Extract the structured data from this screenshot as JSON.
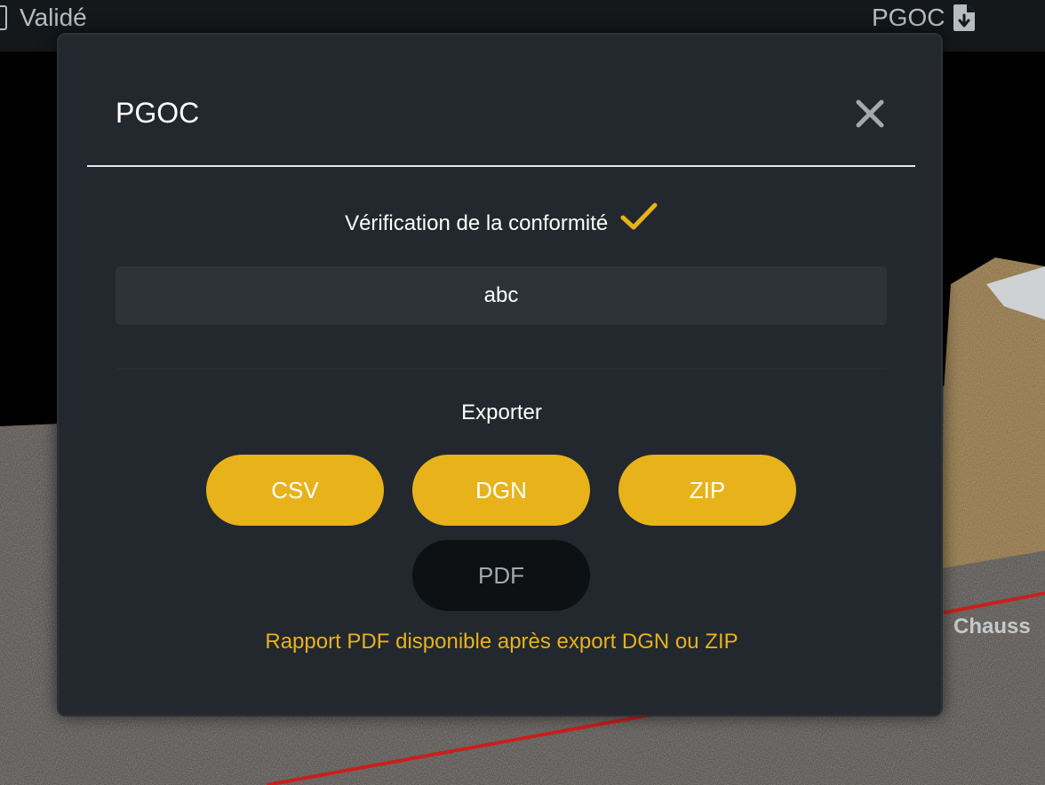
{
  "topbar": {
    "status_label": "Validé",
    "right_label": "PGOC",
    "right_icon": "file-download-icon"
  },
  "scene": {
    "overlay_label": "Chauss"
  },
  "modal": {
    "title": "PGOC",
    "close_icon": "close-icon",
    "verification_label": "Vérification de la conformité",
    "verification_icon": "checkmark-icon",
    "value": "abc",
    "export_title": "Exporter",
    "buttons": {
      "csv": "CSV",
      "dgn": "DGN",
      "zip": "ZIP",
      "pdf": "PDF"
    },
    "note": "Rapport PDF disponible après export DGN ou ZIP"
  },
  "colors": {
    "accent": "#e8b21b",
    "modal_bg": "#22282d",
    "field_bg": "#2d3339",
    "disabled_btn": "#0e1113"
  }
}
